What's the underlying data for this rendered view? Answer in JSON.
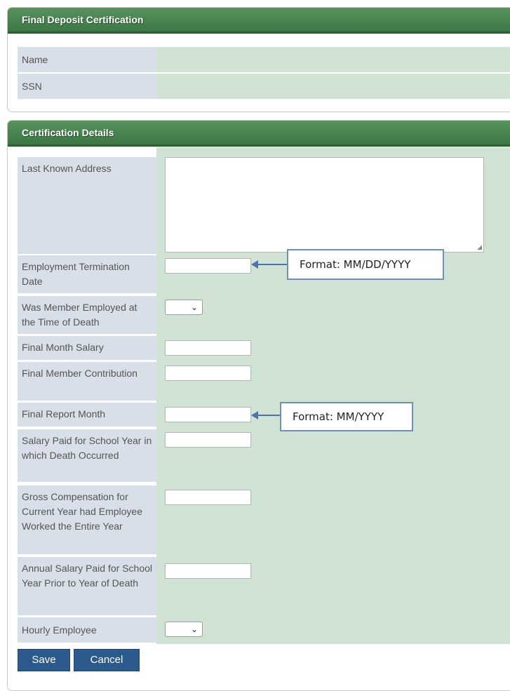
{
  "panel1": {
    "title": "Final Deposit Certification",
    "fields": {
      "name": "Name",
      "ssn": "SSN"
    }
  },
  "panel2": {
    "title": "Certification Details",
    "fields": {
      "last_known_address": "Last Known Address",
      "employment_termination_date": "Employment Termination Date",
      "employed_at_death": "Was Member Employed at the Time of Death",
      "final_month_salary": "Final Month Salary",
      "final_member_contribution": "Final Member Contribution",
      "final_report_month": "Final Report Month",
      "salary_paid_school_year": "Salary Paid for School Year in which Death Occurred",
      "gross_compensation": "Gross Compensation for Current Year had Employee Worked the Entire Year",
      "annual_salary_prior": "Annual Salary Paid for School Year Prior to Year of Death",
      "hourly_employee": "Hourly Employee"
    },
    "select_icon": "chevron-down-icon"
  },
  "callouts": {
    "date_format": "Format: MM/DD/YYYY",
    "month_format": "Format: MM/YYYY"
  },
  "buttons": {
    "save": "Save",
    "cancel": "Cancel"
  },
  "colors": {
    "header_green": "#3b7644",
    "label_bg": "#d8dfe8",
    "value_bg": "#cfe2d4",
    "button_blue": "#2c5a8c",
    "callout_border": "#6f8fb8"
  }
}
